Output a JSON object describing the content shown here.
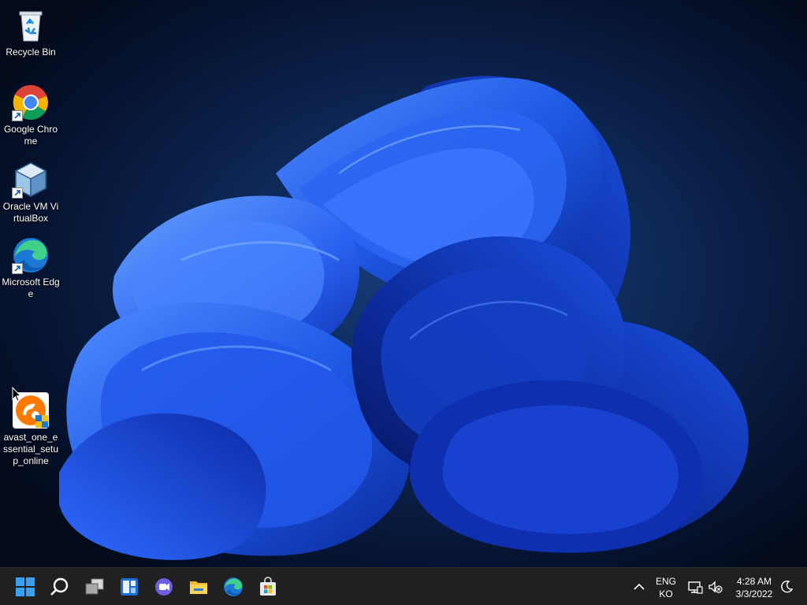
{
  "desktop": {
    "icons": [
      {
        "label": "Recycle Bin",
        "icon": "recycle-bin-icon"
      },
      {
        "label": "Google Chrome",
        "icon": "chrome-icon"
      },
      {
        "label": "Oracle VM VirtualBox",
        "icon": "virtualbox-icon"
      },
      {
        "label": "Microsoft Edge",
        "icon": "edge-icon"
      },
      {
        "label": "avast_one_essential_setup_online",
        "icon": "avast-icon"
      }
    ]
  },
  "taskbar": {
    "apps": [
      {
        "name": "Start",
        "icon": "windows-start-icon"
      },
      {
        "name": "Search",
        "icon": "search-icon"
      },
      {
        "name": "Task View",
        "icon": "task-view-icon"
      },
      {
        "name": "Widgets",
        "icon": "widgets-icon"
      },
      {
        "name": "Chat",
        "icon": "chat-icon"
      },
      {
        "name": "File Explorer",
        "icon": "file-explorer-icon"
      },
      {
        "name": "Microsoft Edge",
        "icon": "edge-icon"
      },
      {
        "name": "Microsoft Store",
        "icon": "store-icon"
      }
    ],
    "tray": {
      "lang_line1": "ENG",
      "lang_line2": "KO",
      "time": "4:28 AM",
      "date": "3/3/2022"
    }
  },
  "colors": {
    "taskbar_bg": "#202020",
    "accent_blue": "#1f6fe0",
    "wallpaper_dark": "#071430"
  }
}
